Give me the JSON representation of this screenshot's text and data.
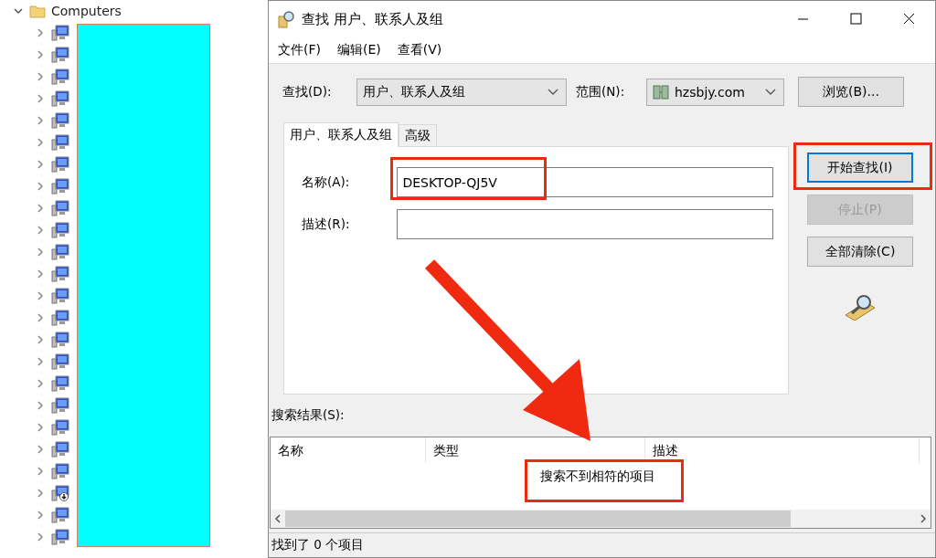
{
  "tree": {
    "root": {
      "label": "Computers",
      "expanded": true,
      "children": [
        {
          "expanded": false,
          "disabled": false
        },
        {
          "expanded": false,
          "disabled": false
        },
        {
          "expanded": false,
          "disabled": false
        },
        {
          "expanded": false,
          "disabled": false
        },
        {
          "expanded": false,
          "disabled": false
        },
        {
          "expanded": false,
          "disabled": false
        },
        {
          "expanded": false,
          "disabled": false
        },
        {
          "expanded": false,
          "disabled": false
        },
        {
          "expanded": false,
          "disabled": false
        },
        {
          "expanded": false,
          "disabled": false
        },
        {
          "expanded": false,
          "disabled": false
        },
        {
          "expanded": false,
          "disabled": false
        },
        {
          "expanded": false,
          "disabled": false
        },
        {
          "expanded": false,
          "disabled": false
        },
        {
          "expanded": false,
          "disabled": false
        },
        {
          "expanded": false,
          "disabled": false
        },
        {
          "expanded": false,
          "disabled": false
        },
        {
          "expanded": false,
          "disabled": false
        },
        {
          "expanded": false,
          "disabled": false
        },
        {
          "expanded": false,
          "disabled": false
        },
        {
          "expanded": false,
          "disabled": false
        },
        {
          "expanded": false,
          "disabled": true
        },
        {
          "expanded": false,
          "disabled": false
        },
        {
          "expanded": false,
          "disabled": false
        }
      ]
    }
  },
  "window": {
    "title": "查找 用户、联系人及组"
  },
  "menu": [
    "文件(F)",
    "编辑(E)",
    "查看(V)"
  ],
  "find_row": {
    "find_label": "查找(D):",
    "find_value": "用户、联系人及组",
    "scope_label": "范围(N):",
    "scope_value": "hzsbjy.com",
    "browse": "浏览(B)..."
  },
  "tabs": [
    {
      "label": "用户、联系人及组",
      "selected": true
    },
    {
      "label": "高级",
      "selected": false
    }
  ],
  "fields": [
    {
      "label": "名称(A):",
      "value": "DESKTOP-QJ5V"
    },
    {
      "label": "描述(R):"
    }
  ],
  "buttons": [
    {
      "label": "开始查找(I)",
      "disabled": false,
      "focused": true
    },
    {
      "label": "停止(P)",
      "disabled": true,
      "focused": false
    },
    {
      "label": "全部清除(C)",
      "disabled": false,
      "focused": false
    }
  ],
  "results": {
    "label": "搜索结果(S):",
    "columns": [
      "名称",
      "类型",
      "描述"
    ],
    "empty_text": "搜索不到相符的项目"
  },
  "status_bar": "找到了 0 个项目"
}
